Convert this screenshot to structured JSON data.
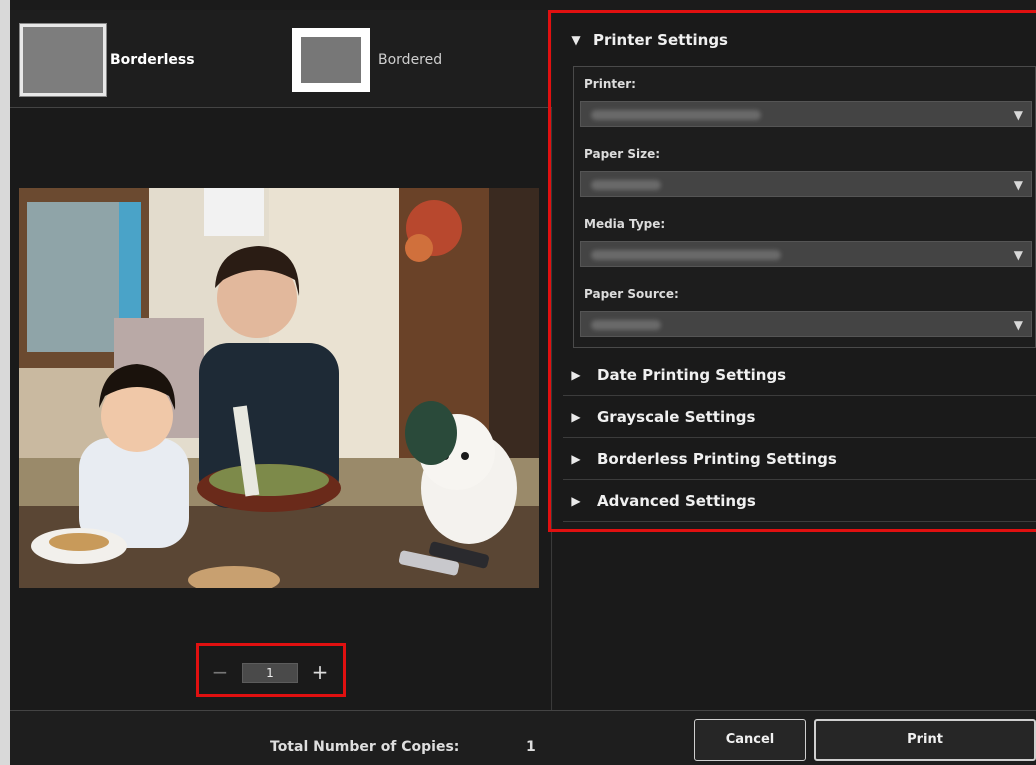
{
  "layouts": {
    "borderless_label": "Borderless",
    "bordered_label": "Bordered"
  },
  "copies": {
    "minus_icon": "−",
    "plus_icon": "+",
    "value": "1"
  },
  "printer_settings": {
    "title": "Printer Settings",
    "expanded_icon": "▼",
    "fields": [
      {
        "label": "Printer:"
      },
      {
        "label": "Paper Size:"
      },
      {
        "label": "Media Type:"
      },
      {
        "label": "Paper Source:"
      }
    ],
    "dropdown_icon": "▼"
  },
  "sections": [
    {
      "label": "Date Printing Settings",
      "icon": "▶"
    },
    {
      "label": "Grayscale Settings",
      "icon": "▶"
    },
    {
      "label": "Borderless Printing Settings",
      "icon": "▶"
    },
    {
      "label": "Advanced Settings",
      "icon": "▶"
    }
  ],
  "footer": {
    "total_label": "Total Number of Copies:",
    "total_value": "1",
    "cancel_label": "Cancel",
    "print_label": "Print"
  },
  "colors": {
    "highlight": "#e01010",
    "background": "#1a1a1a"
  }
}
